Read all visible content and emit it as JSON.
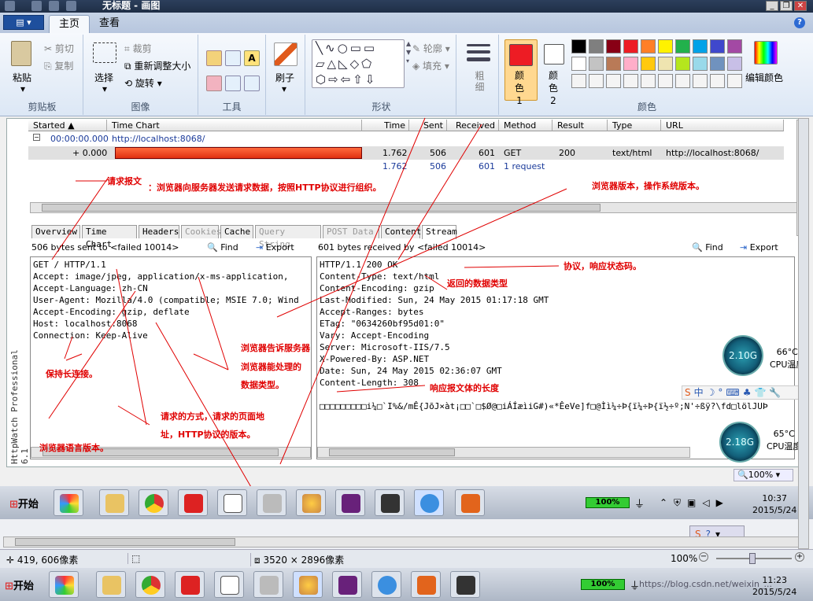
{
  "window": {
    "title": "无标题 - 画图"
  },
  "ribbon": {
    "tabs": [
      {
        "label": "主页"
      },
      {
        "label": "查看"
      }
    ],
    "clipboard": {
      "paste": "粘贴",
      "cut": "剪切",
      "copy": "复制",
      "label": "剪贴板"
    },
    "image": {
      "select": "选择",
      "crop": "裁剪",
      "resize": "重新调整大小",
      "rotate": "旋转",
      "label": "图像"
    },
    "tools": {
      "label": "工具"
    },
    "brush": {
      "label": "刷子"
    },
    "shapes": {
      "outline": "轮廓",
      "fill": "填充",
      "label": "形状"
    },
    "size": {
      "label": "粗细"
    },
    "colors": {
      "color1": "颜色 1",
      "color2": "颜色 2",
      "edit": "编辑颜色",
      "label": "颜色",
      "palette_row1": [
        "#000000",
        "#7f7f7f",
        "#880015",
        "#ed1c24",
        "#ff7f27",
        "#fff200",
        "#22b14c",
        "#00a2e8",
        "#3f48cc",
        "#a349a4"
      ],
      "palette_row2": [
        "#ffffff",
        "#c3c3c3",
        "#b97a57",
        "#ffaec9",
        "#ffc90e",
        "#efe4b0",
        "#b5e61d",
        "#99d9ea",
        "#7092be",
        "#c8bfe7"
      ]
    }
  },
  "httpwatch": {
    "vertical_title": "HttpWatch Professional 6.1",
    "columns": [
      "Started",
      "Time Chart",
      "Time",
      "Sent",
      "Received",
      "Method",
      "Result",
      "Type",
      "URL"
    ],
    "page_row": {
      "started": "00:00:00.000",
      "url": "http://localhost:8068/"
    },
    "request_row": {
      "started": "+ 0.000",
      "time": "1.762",
      "sent": "506",
      "received": "601",
      "method": "GET",
      "result": "200",
      "type": "text/html",
      "url": "http://localhost:8068/"
    },
    "summary_row": {
      "time": "1.762",
      "sent": "506",
      "received": "601",
      "count": "1 request"
    },
    "detail_tabs": [
      {
        "label": "Overview",
        "disabled": false
      },
      {
        "label": "Time Chart",
        "disabled": false
      },
      {
        "label": "Headers",
        "disabled": false
      },
      {
        "label": "Cookies",
        "disabled": true
      },
      {
        "label": "Cache",
        "disabled": false
      },
      {
        "label": "Query String",
        "disabled": true
      },
      {
        "label": "POST Data",
        "disabled": true
      },
      {
        "label": "Content",
        "disabled": false
      },
      {
        "label": "Stream",
        "disabled": false
      }
    ],
    "sent_header": "506 bytes sent to <failed 10014>",
    "recv_header": "601 bytes received by <failed 10014>",
    "find": "Find",
    "export": "Export",
    "request_lines": [
      "GET / HTTP/1.1",
      "Accept: image/jpeg, application/x-ms-application,",
      "Accept-Language: zh-CN",
      "User-Agent: Mozilla/4.0 (compatible; MSIE 7.0; Wind",
      "Accept-Encoding: gzip, deflate",
      "Host: localhost:8068",
      "Connection: Keep-Alive"
    ],
    "response_lines": [
      "HTTP/1.1 200 OK",
      "Content-Type: text/html",
      "Content-Encoding: gzip",
      "Last-Modified: Sun, 24 May 2015 01:17:18 GMT",
      "Accept-Ranges: bytes",
      "ETag: \"0634260bf95d01:0\"",
      "Vary: Accept-Encoding",
      "Server: Microsoft-IIS/7.5",
      "X-Powered-By: ASP.NET",
      "Date: Sun, 24 May 2015 02:36:07 GMT",
      "Content-Length: 308",
      "",
      "□□□□□□□□□i¼□`I%&/mÊ{JõJ×àt¡□□`□$Ø@□iÁÍæìiG#)«*ÊeVe]f□@Ìì¼÷Þ{ï¼÷Þ{ï½÷º;N'÷ßÿ?\\fd□lölJUÞ"
    ],
    "zoom": "100%"
  },
  "annotations": {
    "request_msg": "请求报文",
    "request_msg_desc": "：浏览器向服务器发送请求数据，按照HTTP协议进行组织。",
    "browser_os": "浏览器版本，操作系统版本。",
    "protocol_status": "协议，响应状态码。",
    "return_type": "返回的数据类型",
    "tell_server": "浏览器告诉服务器",
    "can_handle": "浏览器能处理的",
    "data_type": "数据类型。",
    "keep_alive": "保持长连接。",
    "method_path1": "请求的方式，请求的页面地",
    "method_path2": "址，HTTP协议的版本。",
    "lang": "浏览器语言版本。",
    "body_len": "响应报文体的长度"
  },
  "cpu": [
    {
      "value": "2.10G",
      "temp": "66°C",
      "label": "CPU温度"
    },
    {
      "value": "2.18G",
      "temp": "65°C",
      "label": "CPU温度"
    }
  ],
  "taskbar_inner": {
    "start": "开始",
    "battery": "100%",
    "time": "10:37",
    "date": "2015/5/24"
  },
  "statusbar": {
    "cursor": "419, 606像素",
    "canvas": "3520 × 2896像素",
    "zoom": "100%"
  },
  "taskbar_outer": {
    "start": "开始",
    "battery": "100%",
    "time": "11:23",
    "date": "2015/5/24",
    "watermark": "https://blog.csdn.net/weixin_..."
  }
}
